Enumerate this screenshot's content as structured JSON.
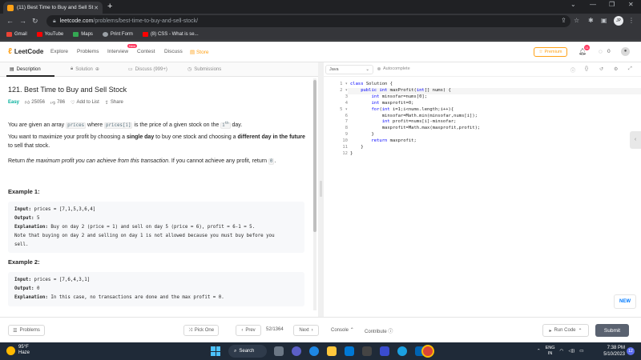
{
  "browser": {
    "tab_title": "(11) Best Time to Buy and Sell St",
    "url_domain": "leetcode.com",
    "url_path": "/problems/best-time-to-buy-and-sell-stock/",
    "bookmarks": [
      {
        "label": "Gmail",
        "color": "#ea4335"
      },
      {
        "label": "YouTube",
        "color": "#ff0000"
      },
      {
        "label": "Maps",
        "color": "#34a853"
      },
      {
        "label": "Print Form",
        "color": "#9aa0a6"
      },
      {
        "label": "(8) CSS - What is se...",
        "color": "#ff0000"
      }
    ],
    "profile_initial": "JP"
  },
  "nav": {
    "brand": "LeetCode",
    "links": [
      "Explore",
      "Problems",
      "Interview",
      "Contest",
      "Discuss",
      "Store"
    ],
    "new_badge": "New",
    "premium": "Premium",
    "notifications": "11",
    "streak": "0"
  },
  "left_tabs": [
    "Description",
    "Solution",
    "Discuss (999+)",
    "Submissions"
  ],
  "problem": {
    "title": "121. Best Time to Buy and Sell Stock",
    "difficulty": "Easy",
    "likes": "25056",
    "dislikes": "786",
    "add_to_list": "Add to List",
    "share": "Share",
    "p1_a": "You are given an array ",
    "p1_code1": "prices",
    "p1_b": " where ",
    "p1_code2": "prices[i]",
    "p1_c": " is the price of a given stock on the ",
    "p1_code3": "i",
    "p1_sup": "th",
    "p1_d": " day.",
    "p2_a": "You want to maximize your profit by choosing a ",
    "p2_b1": "single day",
    "p2_b": " to buy one stock and choosing a ",
    "p2_b2": "different day in the future",
    "p2_c": " to sell that stock.",
    "p3_a": "Return ",
    "p3_i": "the maximum profit you can achieve from this transaction",
    "p3_b": ". If you cannot achieve any profit, return ",
    "p3_code": "0",
    "p3_c": "."
  },
  "examples": [
    {
      "heading": "Example 1:",
      "input_label": "Input:",
      "input": "prices = [7,1,5,3,6,4]",
      "output_label": "Output:",
      "output": "5",
      "expl_label": "Explanation:",
      "explanation": "Buy on day 2 (price = 1) and sell on day 5 (price = 6), profit = 6-1 = 5.",
      "note": "Note that buying on day 2 and selling on day 1 is not allowed because you must buy before you",
      "note2": "sell."
    },
    {
      "heading": "Example 2:",
      "input_label": "Input:",
      "input": "prices = [7,6,4,3,1]",
      "output_label": "Output:",
      "output": "0",
      "expl_label": "Explanation:",
      "explanation": "In this case, no transactions are done and the max profit = 0."
    }
  ],
  "editor": {
    "language": "Java",
    "autocomplete": "Autocomplete",
    "line_numbers": [
      "1",
      "2",
      "3",
      "4",
      "5",
      "6",
      "7",
      "8",
      "9",
      "10",
      "11",
      "12"
    ],
    "lines": [
      "class Solution {",
      "    public int maxProfit(int[] nums) {",
      "        int minsofar=nums[0];",
      "        int maxprofit=0;",
      "        for(int i=1;i<nums.length;i++){",
      "            minsofar=Math.min(minsofar,nums[i]);",
      "            int profit=nums[i]-minsofar;",
      "            maxprofit=Math.max(maxprofit,profit);",
      "        }",
      "        return maxprofit;",
      "    }",
      "}"
    ],
    "new_label": "NEW"
  },
  "bottom": {
    "problems": "Problems",
    "pick_one": "Pick One",
    "prev": "Prev",
    "page": "52/1364",
    "next": "Next",
    "console": "Console",
    "contribute": "Contribute",
    "run_code": "Run Code",
    "submit": "Submit"
  },
  "taskbar": {
    "temp": "95°F",
    "weather": "Haze",
    "search": "Search",
    "lang": "ENG",
    "region": "IN",
    "time": "7:38 PM",
    "date": "5/10/2023",
    "notif": "12"
  }
}
